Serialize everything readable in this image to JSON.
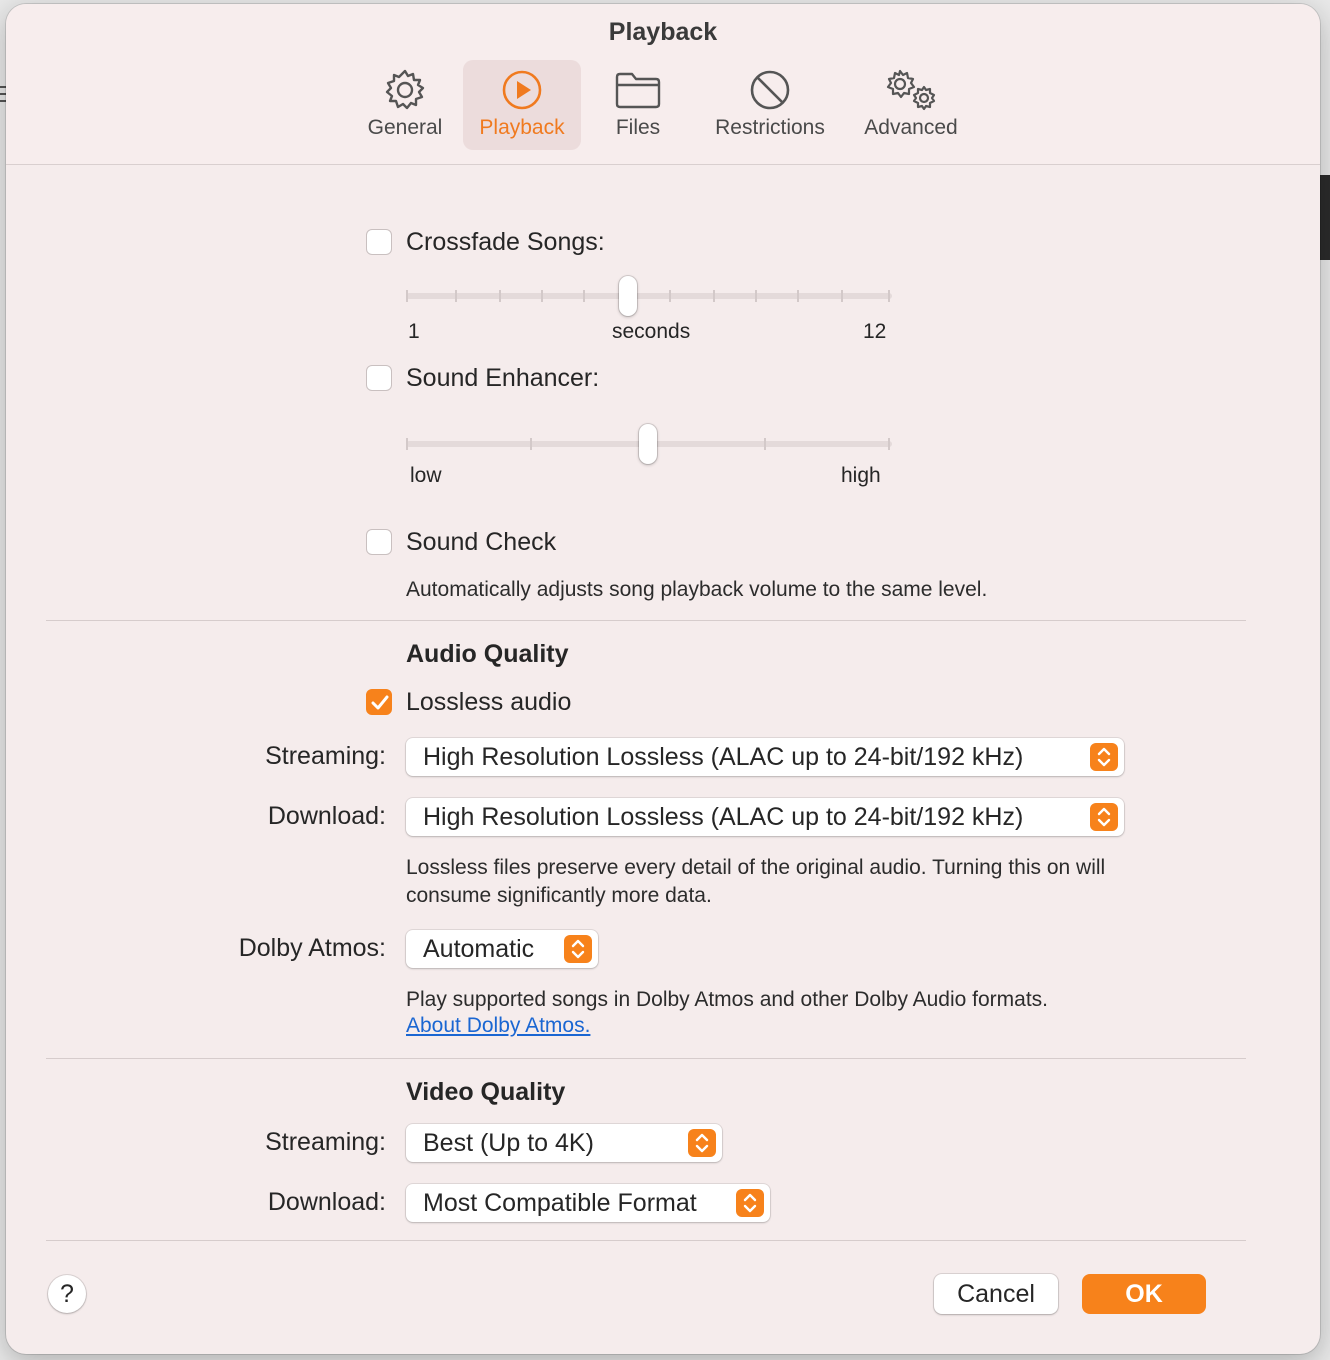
{
  "window": {
    "title": "Playback"
  },
  "tabs": [
    {
      "label": "General"
    },
    {
      "label": "Playback"
    },
    {
      "label": "Files"
    },
    {
      "label": "Restrictions"
    },
    {
      "label": "Advanced"
    }
  ],
  "crossfade": {
    "label": "Crossfade Songs:",
    "checked": false,
    "min_label": "1",
    "mid_label": "seconds",
    "max_label": "12",
    "value": 6
  },
  "enhancer": {
    "label": "Sound Enhancer:",
    "checked": false,
    "low_label": "low",
    "high_label": "high",
    "level": 0.5
  },
  "sound_check": {
    "label": "Sound Check",
    "checked": false,
    "description": "Automatically adjusts song playback volume to the same level."
  },
  "audio_quality": {
    "title": "Audio Quality",
    "lossless_label": "Lossless audio",
    "lossless_checked": true,
    "streaming_label": "Streaming:",
    "streaming_value": "High Resolution Lossless (ALAC up to 24-bit/192 kHz)",
    "download_label": "Download:",
    "download_value": "High Resolution Lossless (ALAC up to 24-bit/192 kHz)",
    "description": "Lossless files preserve every detail of the original audio. Turning this on will consume significantly more data.",
    "dolby_label": "Dolby Atmos:",
    "dolby_value": "Automatic",
    "dolby_description": "Play supported songs in Dolby Atmos and other Dolby Audio formats.",
    "dolby_link": "About Dolby Atmos."
  },
  "video_quality": {
    "title": "Video Quality",
    "streaming_label": "Streaming:",
    "streaming_value": "Best (Up to 4K)",
    "download_label": "Download:",
    "download_value": "Most Compatible Format"
  },
  "footer": {
    "help": "?",
    "cancel": "Cancel",
    "ok": "OK"
  },
  "colors": {
    "accent": "#f7821b",
    "link": "#1a66d2",
    "background": "#f5ecec"
  }
}
